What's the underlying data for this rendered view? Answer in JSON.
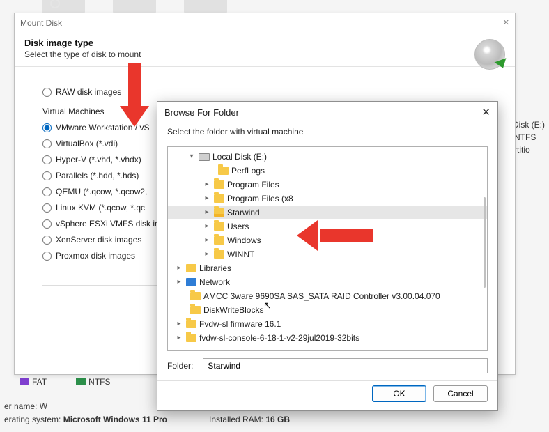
{
  "background": {
    "legend_fat": "FAT",
    "legend_ntfs": "NTFS",
    "user_label": "er name:",
    "user_value": "W",
    "os_label": "erating system:",
    "os_value": "Microsoft Windows 11 Pro",
    "ram_label": "Installed RAM:",
    "ram_value": "16 GB",
    "right_line1": "al Disk (E:)",
    "right_line2": "B [NTFS",
    "right_line3": "Partitio"
  },
  "mount": {
    "title": "Mount Disk",
    "heading": "Disk image type",
    "sub": "Select the type of disk to mount",
    "raw_label": "RAW disk images",
    "vm_section": "Virtual Machines",
    "options": {
      "vmware": "VMware Workstation / vS",
      "vbox": "VirtualBox (*.vdi)",
      "hyperv": "Hyper-V (*.vhd, *.vhdx)",
      "parallels": "Parallels (*.hdd, *.hds)",
      "qemu": "QEMU (*.qcow, *.qcow2,",
      "kvm": "Linux KVM (*.qcow, *.qc",
      "esxi": "vSphere ESXi VMFS disk in",
      "xen": "XenServer disk images",
      "proxmox": "Proxmox disk images"
    }
  },
  "browse": {
    "title": "Browse For Folder",
    "sub": "Select the folder with virtual machine",
    "folder_label": "Folder:",
    "folder_value": "Starwind",
    "ok": "OK",
    "cancel": "Cancel",
    "tree": {
      "drive": "Local Disk (E:)",
      "perflogs": "PerfLogs",
      "progfiles": "Program Files",
      "progfiles86": "Program Files (x8",
      "starwind": "Starwind",
      "users": "Users",
      "windows": "Windows",
      "winnt": "WINNT",
      "libraries": "Libraries",
      "network": "Network",
      "amcc": "AMCC 3ware 9690SA SAS_SATA RAID Controller v3.00.04.070",
      "dwb": "DiskWriteBlocks",
      "fw1": "Fvdw-sl firmware 16.1",
      "fw2": "fvdw-sl-console-6-18-1-v2-29jul2019-32bits"
    }
  }
}
